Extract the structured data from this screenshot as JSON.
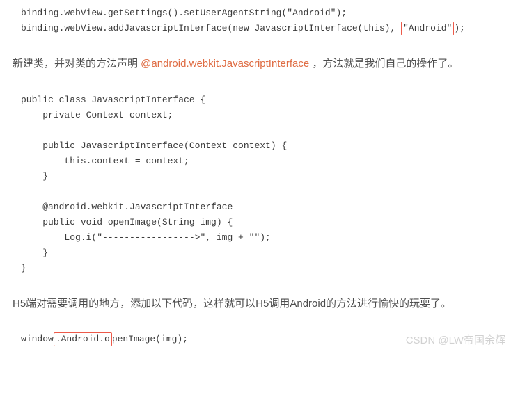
{
  "code1": {
    "line1": "binding.webView.getSettings().setUserAgentString(\"Android\");",
    "line2a": "binding.webView.addJavascriptInterface(new JavascriptInterface(this),",
    "line2_hl": "\"Android\"",
    "line2b": ");"
  },
  "para1": {
    "pre": "新建类，并对类的方法声明  ",
    "ref": "@android.webkit.JavascriptInterface",
    "post": " ，方法就是我们自己的操作了。"
  },
  "code2_text": "public class JavascriptInterface {\n    private Context context;\n\n    public JavascriptInterface(Context context) {\n        this.context = context;\n    }\n\n    @android.webkit.JavascriptInterface\n    public void openImage(String img) {\n        Log.i(\"----------------->\", img + \"\");\n    }\n}",
  "para2": "H5端对需要调用的地方，添加以下代码，这样就可以H5调用Android的方法进行愉快的玩耍了。",
  "code3": {
    "a": "window",
    "hl": ".Android.o",
    "b": "penImage(img);"
  },
  "watermark": "CSDN @LW帝国余辉"
}
